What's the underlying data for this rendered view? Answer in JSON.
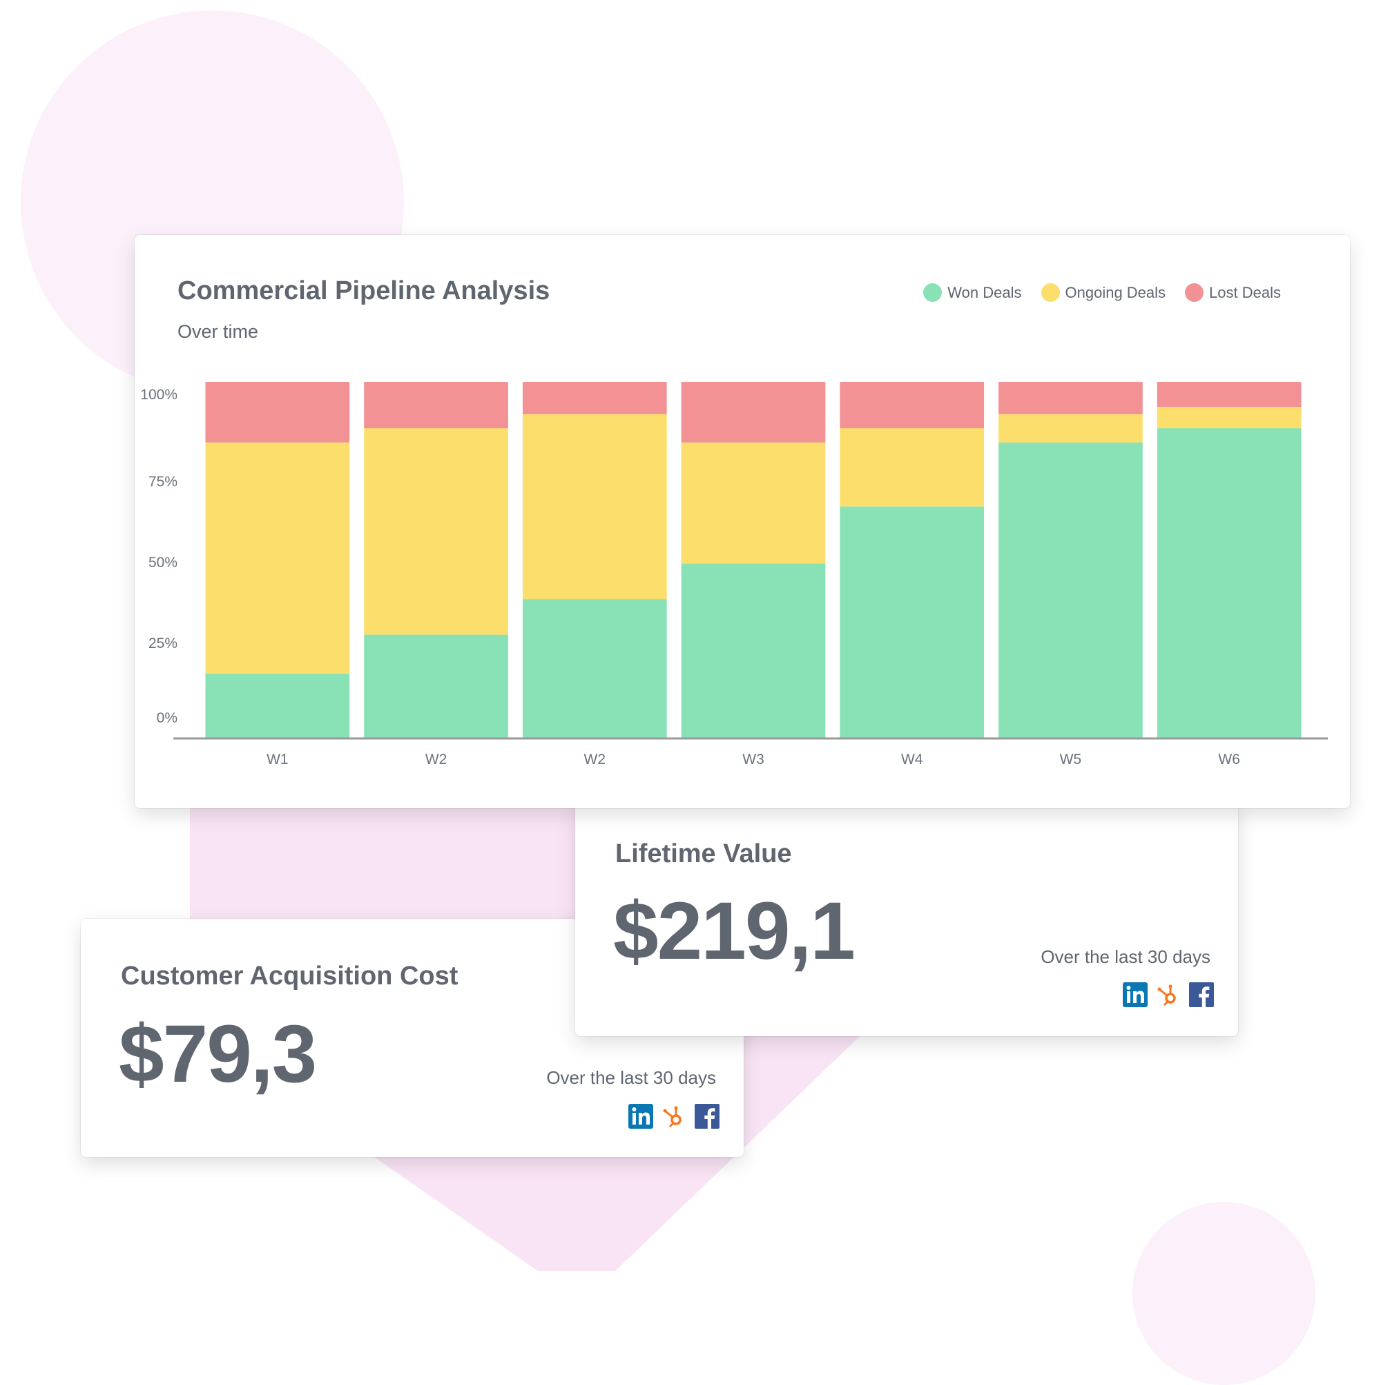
{
  "colors": {
    "won": "#88e2b5",
    "ongoing": "#fcde6c",
    "lost": "#f29294",
    "text": "#5f6670",
    "axis": "#999999",
    "linkedin": "#0a77b5",
    "hubspot": "#f57722",
    "facebook": "#3b5998"
  },
  "chart_data": {
    "type": "bar",
    "stacked": true,
    "title": "Commercial Pipeline Analysis",
    "subtitle": "Over time",
    "xlabel": "",
    "ylabel": "",
    "ylim": [
      0,
      100
    ],
    "y_ticks": [
      "0%",
      "25%",
      "50%",
      "75%",
      "100%"
    ],
    "categories": [
      "W1",
      "W2",
      "W2",
      "W3",
      "W4",
      "W5",
      "W6"
    ],
    "legend_position": "top-right",
    "grid": false,
    "series": [
      {
        "name": "Won Deals",
        "key": "won",
        "values": [
          18,
          29,
          39,
          49,
          65,
          83,
          87
        ]
      },
      {
        "name": "Ongoing Deals",
        "key": "ongoing",
        "values": [
          65,
          58,
          52,
          34,
          22,
          8,
          6
        ]
      },
      {
        "name": "Lost Deals",
        "key": "lost",
        "values": [
          17,
          13,
          9,
          17,
          13,
          9,
          7
        ]
      }
    ]
  },
  "kpis": {
    "ltv": {
      "title": "Lifetime Value",
      "value": "$219,1",
      "period": "Over the last 30 days",
      "sources": [
        "linkedin-icon",
        "hubspot-icon",
        "facebook-icon"
      ]
    },
    "cac": {
      "title": "Customer Acquisition Cost",
      "value": "$79,3",
      "period": "Over the last 30 days",
      "sources": [
        "linkedin-icon",
        "hubspot-icon",
        "facebook-icon"
      ]
    }
  }
}
